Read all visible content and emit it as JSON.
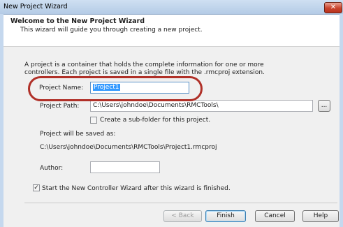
{
  "window": {
    "title": "New Project Wizard",
    "close_glyph": "✕"
  },
  "header": {
    "title": "Welcome to the New Project Wizard",
    "subtitle": "This wizard will guide you through creating a new project."
  },
  "description": {
    "line1": "A project is a container that holds the complete information for one or more",
    "line2": "controllers. Each project is saved in a single file with the .rmcproj extension."
  },
  "form": {
    "project_name_label": "Project Name:",
    "project_name_value": "Project1",
    "project_path_label": "Project Path:",
    "project_path_value": "C:\\Users\\johndoe\\Documents\\RMCTools\\",
    "browse_label": "...",
    "subfolder_label": "Create a sub-folder for this project.",
    "subfolder_checked": false,
    "saved_as_label": "Project will be saved as:",
    "saved_as_path": "C:\\Users\\johndoe\\Documents\\RMCTools\\Project1.rmcproj",
    "author_label": "Author:",
    "author_value": "",
    "start_wizard_label": "Start the New Controller Wizard after this wizard is finished.",
    "start_wizard_checked": true,
    "check_glyph": "✓"
  },
  "buttons": {
    "back": "< Back",
    "finish": "Finish",
    "cancel": "Cancel",
    "help": "Help"
  },
  "colors": {
    "annotation_outline": "#b03028",
    "selection": "#3399ff"
  }
}
